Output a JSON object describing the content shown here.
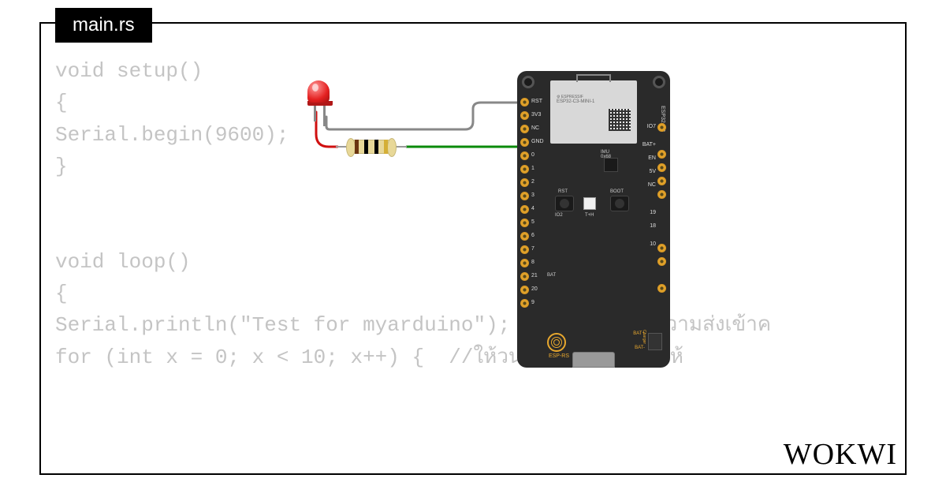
{
  "tab": {
    "filename": "main.rs"
  },
  "code": {
    "lines": [
      "void setup()",
      "{",
      "Serial.begin(9600);",
      "}",
      "",
      "",
      "void loop()",
      "{",
      "Serial.println(\"Test for myarduino\");  // พิมพ์ข้อมความส่งเข้าค",
      "for (int x = 0; x < 10; x++) {  //ให้วนรอบโดยกำหนดให้"
    ]
  },
  "board": {
    "chip_brand": "ESPRESSIF",
    "chip_model": "ESP32-C3-MINI-1",
    "side_label": "ESP32-C3",
    "imu_label": "IMU\n0x68",
    "logo_text": "ESP-RS",
    "pins_left": [
      "RST",
      "3V3",
      "NC",
      "GND",
      "0",
      "1",
      "2",
      "3",
      "4",
      "5",
      "6",
      "7",
      "8",
      "21",
      "20",
      "9"
    ],
    "pins_right": [
      "IO7",
      "",
      "BAT+",
      "EN",
      "5V",
      "NC",
      "",
      "",
      "",
      "19",
      "18",
      "",
      "10",
      ""
    ],
    "btn_rst": "RST",
    "btn_th": "T+H",
    "btn_boot": "BOOT",
    "io2": "IO2",
    "bat": "BAT",
    "charger": "Charger",
    "bat_plus": "BAT+",
    "bat_minus": "BAT-"
  },
  "components": {
    "led_color": "#e42020",
    "resistor_bands": [
      "brown",
      "black",
      "gold"
    ],
    "wires": [
      {
        "name": "gnd-wire",
        "color": "#888888"
      },
      {
        "name": "gpio0-wire",
        "color": "#0a8a0a"
      },
      {
        "name": "led-anode-wire",
        "color": "#d01010"
      }
    ]
  },
  "logo": "WOKWI"
}
